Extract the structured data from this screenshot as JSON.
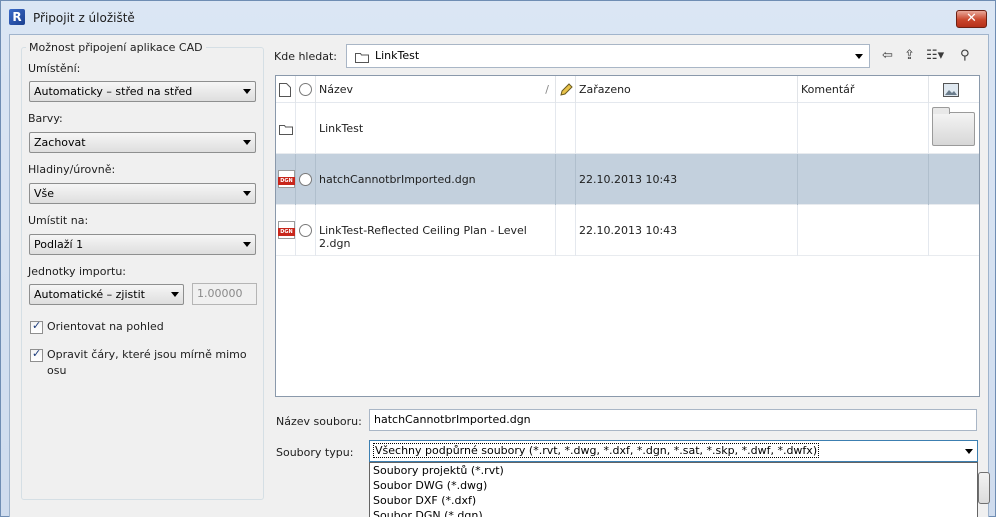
{
  "window": {
    "title": "Připojit z úložiště",
    "close_glyph": "✕",
    "app_icon_letter": "R"
  },
  "options": {
    "group_title": "Možnost připojení aplikace CAD",
    "placement_label": "Umístění:",
    "placement_value": "Automaticky – střed na střed",
    "colors_label": "Barvy:",
    "colors_value": "Zachovat",
    "layers_label": "Hladiny/úrovně:",
    "layers_value": "Vše",
    "place_at_label": "Umístit na:",
    "place_at_value": "Podlaží 1",
    "units_label": "Jednotky importu:",
    "units_value": "Automatické – zjistit",
    "scale_value": "1.00000",
    "orient_label": "Orientovat na pohled",
    "fix_lines_label_1": "Opravit čáry, které jsou mírně mimo",
    "fix_lines_label_2": "osu"
  },
  "lookin": {
    "label": "Kde hledat:",
    "value": "LinkTest"
  },
  "toolbar": {
    "back": "⇦",
    "up": "⇪",
    "views": "☷▾",
    "find": "⚲"
  },
  "list": {
    "columns": {
      "name": "Název",
      "sort_mark": "/",
      "filed": "Zařazeno",
      "comment": "Komentář"
    },
    "rows": [
      {
        "name": "LinkTest",
        "date": "",
        "comment": ""
      },
      {
        "name": "hatchCannotbrImported.dgn",
        "date": "22.10.2013 10:43",
        "comment": "",
        "badge": "DGN"
      },
      {
        "name": "LinkTest-Reflected Ceiling Plan - Level 2.dgn",
        "date": "22.10.2013 10:43",
        "comment": "",
        "badge": "DGN"
      }
    ]
  },
  "file": {
    "name_label": "Název souboru:",
    "name_value": "hatchCannotbrImported.dgn",
    "type_label": "Soubory typu:",
    "type_value": "Všechny podpůrné soubory (*.rvt, *.dwg, *.dxf, *.dgn, *.sat, *.skp, *.dwf, *.dwfx)",
    "type_options": [
      "Soubory projektů (*.rvt)",
      "Soubor DWG (*.dwg)",
      "Soubor DXF (*.dxf)",
      "Soubor DGN (*.dgn)"
    ]
  }
}
